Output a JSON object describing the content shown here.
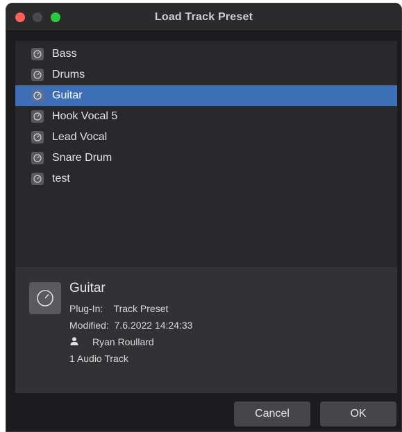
{
  "window": {
    "title": "Load Track Preset"
  },
  "presets": [
    {
      "label": "Bass",
      "icon": "preset-knob-icon"
    },
    {
      "label": "Drums",
      "icon": "preset-knob-icon"
    },
    {
      "label": "Guitar",
      "icon": "preset-knob-icon",
      "selected": true
    },
    {
      "label": "Hook Vocal 5",
      "icon": "preset-knob-icon"
    },
    {
      "label": "Lead Vocal",
      "icon": "preset-knob-icon"
    },
    {
      "label": "Snare Drum",
      "icon": "preset-knob-icon"
    },
    {
      "label": "test",
      "icon": "preset-knob-icon"
    }
  ],
  "detail": {
    "name": "Guitar",
    "plugin_line": "Plug-In:    Track Preset",
    "modified_line": "Modified:  7.6.2022 14:24:33",
    "author": "Ryan Roullard",
    "tracks": "1 Audio Track"
  },
  "buttons": {
    "cancel": "Cancel",
    "ok": "OK"
  },
  "colors": {
    "selection": "#3d6fb6",
    "close": "#ff5f57",
    "maximize": "#28c840"
  }
}
